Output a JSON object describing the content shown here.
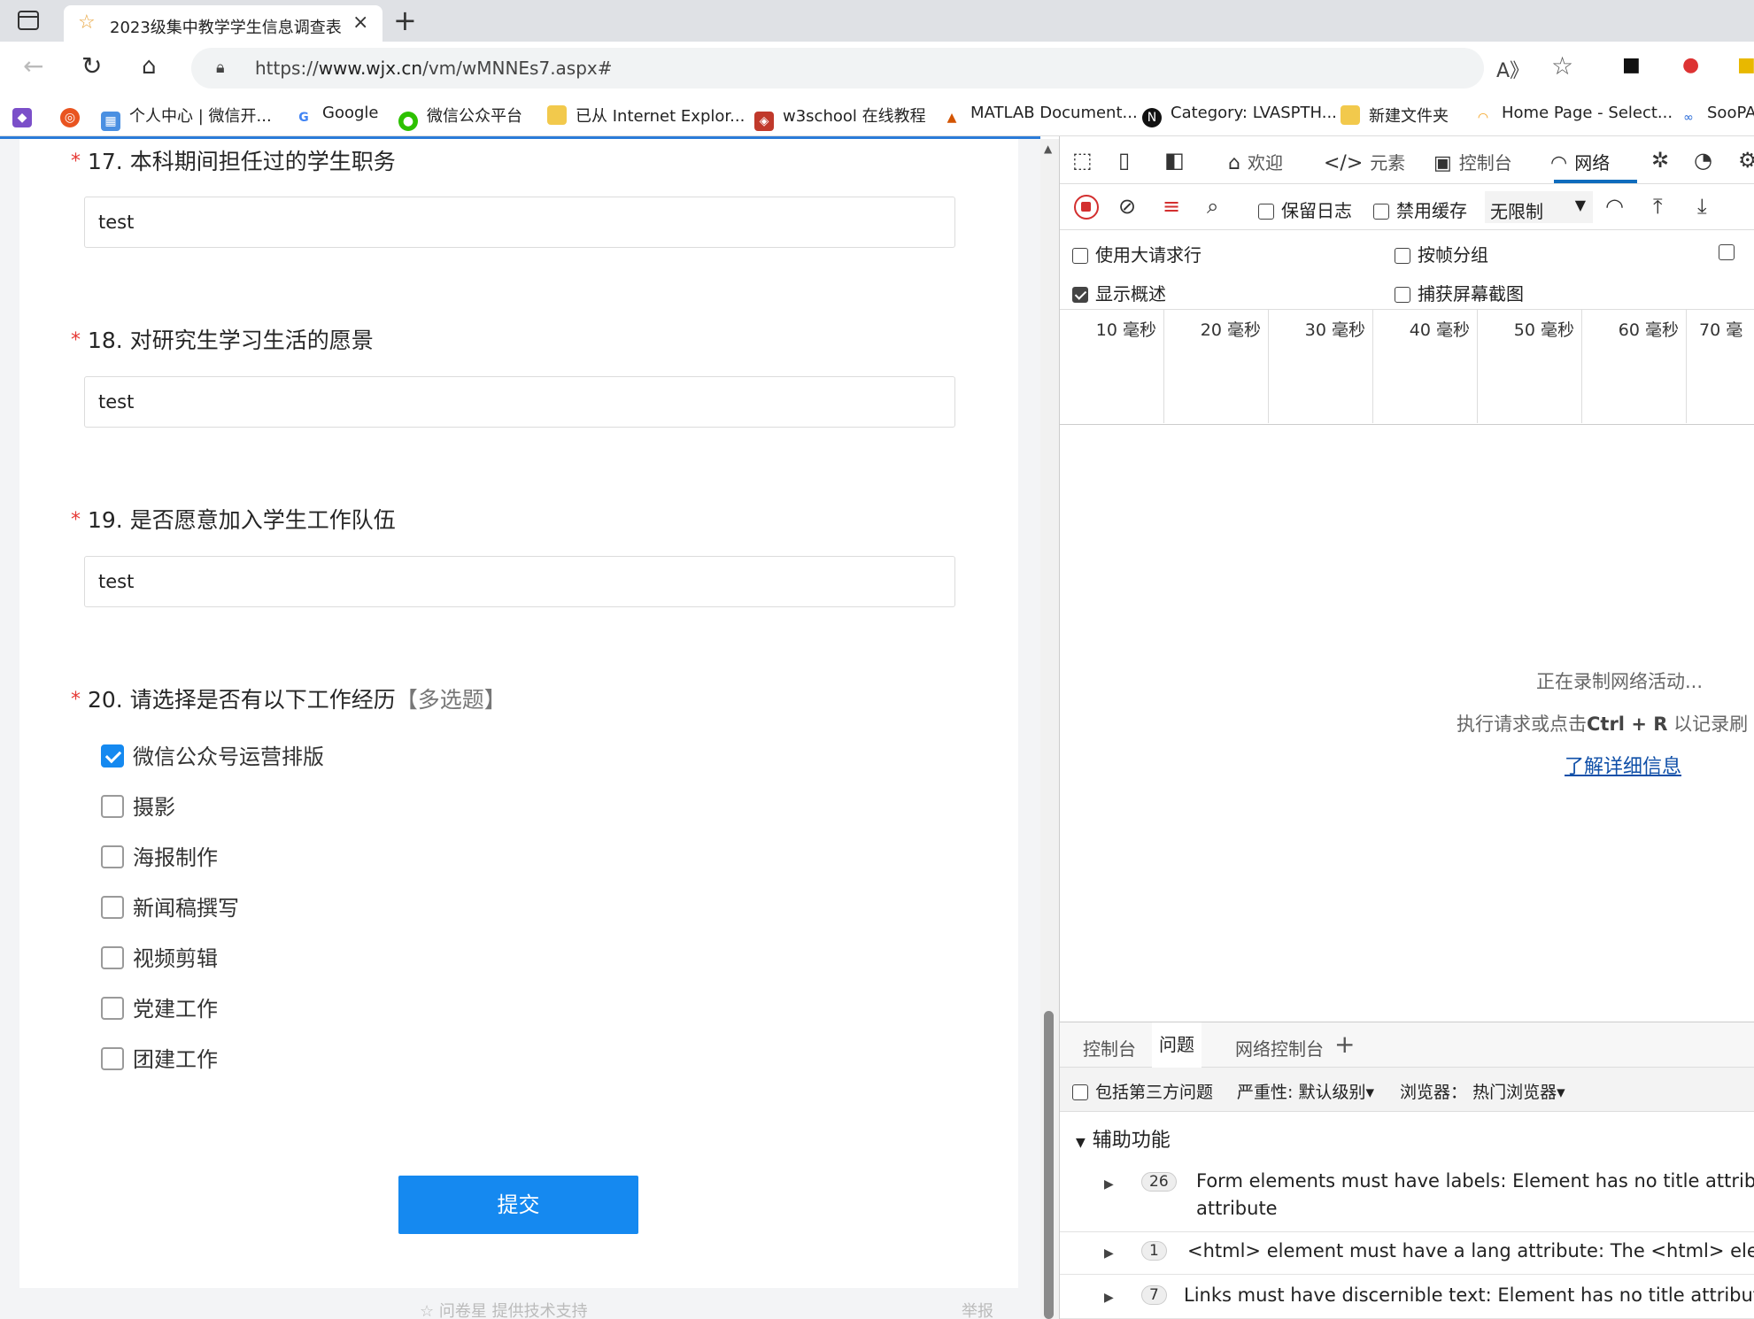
{
  "browser": {
    "tab_title": "2023级集中教学学生信息调查表",
    "url_prefix": "https://",
    "url_host": "www.wjx.cn",
    "url_path": "/vm/wMNNEs7.aspx#",
    "bookmarks": [
      {
        "label": "个人中心 | 微信开..."
      },
      {
        "label": "Google"
      },
      {
        "label": "微信公众平台"
      },
      {
        "label": "已从 Internet Explor..."
      },
      {
        "label": "w3school 在线教程"
      },
      {
        "label": "MATLAB Document..."
      },
      {
        "label": "Category: LVASPTH..."
      },
      {
        "label": "新建文件夹"
      },
      {
        "label": "Home Page - Select..."
      },
      {
        "label": "SooPA"
      }
    ]
  },
  "form": {
    "questions": [
      {
        "number": "17.",
        "title": "本科期间担任过的学生职务",
        "answer": "test"
      },
      {
        "number": "18.",
        "title": "对研究生学习生活的愿景",
        "answer": "test"
      },
      {
        "number": "19.",
        "title": "是否愿意加入学生工作队伍",
        "answer": "test"
      }
    ],
    "q20": {
      "number": "20.",
      "title": "请选择是否有以下工作经历",
      "tag": "【多选题】",
      "options": [
        {
          "label": "微信公众号运营排版",
          "checked": true
        },
        {
          "label": "摄影",
          "checked": false
        },
        {
          "label": "海报制作",
          "checked": false
        },
        {
          "label": "新闻稿撰写",
          "checked": false
        },
        {
          "label": "视频剪辑",
          "checked": false
        },
        {
          "label": "党建工作",
          "checked": false
        },
        {
          "label": "团建工作",
          "checked": false
        }
      ]
    },
    "required_mark": "*",
    "submit_label": "提交",
    "footer_left": "☆ 问卷星 提供技术支持",
    "footer_right": "举报"
  },
  "devtools": {
    "tabs": {
      "welcome": "欢迎",
      "elements": "元素",
      "console": "控制台",
      "network": "网络"
    },
    "toolbar": {
      "preserve_log": "保留日志",
      "disable_cache": "禁用缓存",
      "throttle": "无限制"
    },
    "options": {
      "big_rows": "使用大请求行",
      "group_by_frame": "按帧分组",
      "show_overview": "显示概述",
      "capture_screenshots": "捕获屏幕截图"
    },
    "timeline": [
      "10 毫秒",
      "20 毫秒",
      "30 毫秒",
      "40 毫秒",
      "50 毫秒",
      "60 毫秒",
      "70 毫"
    ],
    "empty": {
      "line1": "正在录制网络活动...",
      "line2_a": "执行请求或点击",
      "line2_key": "Ctrl + R",
      "line2_b": " 以记录刷",
      "learn_more": "了解详细信息"
    },
    "drawer": {
      "tabs": [
        "控制台",
        "问题",
        "网络控制台"
      ],
      "include_third_party": "包括第三方问题",
      "severity": "严重性: 默认级别",
      "browser_label": "浏览器：",
      "browser_value": "热门浏览器",
      "section": "辅助功能",
      "issues": [
        {
          "count": "26",
          "line1": "Form elements must have labels: Element has no title attribute",
          "line2": "attribute"
        },
        {
          "count": "1",
          "line1": "<html> element must have a lang attribute: The <html> eleme"
        },
        {
          "count": "7",
          "line1": "Links must have discernible text: Element has no title attribute"
        }
      ]
    }
  },
  "colors": {
    "accent": "#1589f0",
    "required": "#e53935",
    "devtools_active": "#0f6cbd"
  }
}
